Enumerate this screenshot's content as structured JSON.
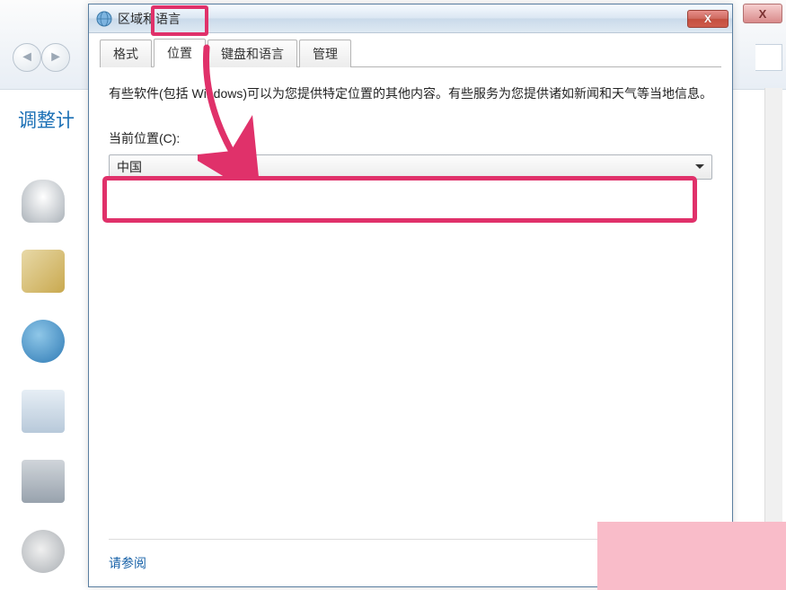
{
  "background": {
    "heading": "调整计",
    "nav_back": "◄",
    "nav_fwd": "►",
    "close_x": "X"
  },
  "dialog": {
    "title": "区域和语言",
    "close_label": "X"
  },
  "tabs": [
    {
      "label": "格式",
      "active": false
    },
    {
      "label": "位置",
      "active": true
    },
    {
      "label": "键盘和语言",
      "active": false
    },
    {
      "label": "管理",
      "active": false
    }
  ],
  "content": {
    "description": "有些软件(包括 Windows)可以为您提供特定位置的其他内容。有些服务为您提供诸如新闻和天气等当地信息。",
    "location_label": "当前位置(C):",
    "location_value": "中国",
    "see_also": "请参阅"
  },
  "annotation": {
    "highlight_color": "#e0316a"
  }
}
